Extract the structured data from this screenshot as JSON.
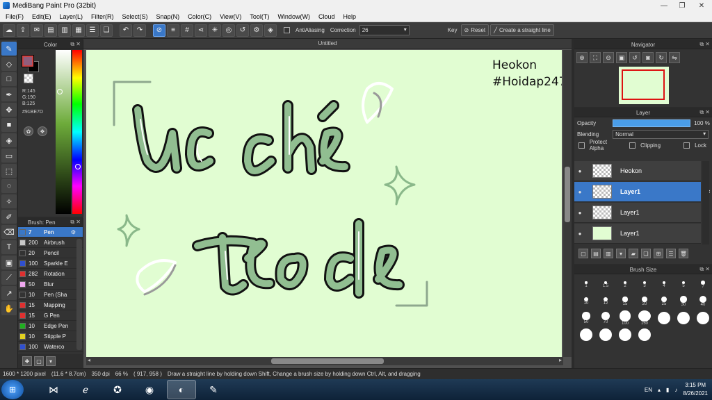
{
  "window": {
    "title": "MediBang Paint Pro (32bit)"
  },
  "menu": [
    "File(F)",
    "Edit(E)",
    "Layer(L)",
    "Filter(R)",
    "Select(S)",
    "Snap(N)",
    "Color(C)",
    "View(V)",
    "Tool(T)",
    "Window(W)",
    "Cloud",
    "Help"
  ],
  "toolbar": {
    "antialiasing_label": "AntiAliasing",
    "correction_label": "Correction",
    "correction_value": "26",
    "key_label": "Key",
    "reset_label": "Reset",
    "straight_line_label": "Create a straight line"
  },
  "color_panel": {
    "title": "Color",
    "r": "R:145",
    "g": "G:190",
    "b": "B:125",
    "hex": "#91BE7D",
    "fg_color": "#915E7D"
  },
  "brush_panel": {
    "title": "Brush: Pen",
    "brushes": [
      {
        "size": "7",
        "name": "Pen",
        "color": "#3a78c8",
        "selected": true
      },
      {
        "size": "200",
        "name": "Airbrush",
        "color": "#c8c8c8"
      },
      {
        "size": "20",
        "name": "Pencil",
        "color": "#333333"
      },
      {
        "size": "100",
        "name": "Sparkle E",
        "color": "#3050d0"
      },
      {
        "size": "282",
        "name": "Rotation",
        "color": "#e03030"
      },
      {
        "size": "50",
        "name": "Blur",
        "color": "#f0a8f0"
      },
      {
        "size": "10",
        "name": "Pen (Sha",
        "color": "#333333"
      },
      {
        "size": "15",
        "name": "Mapping",
        "color": "#e03030"
      },
      {
        "size": "15",
        "name": "G Pen",
        "color": "#e03030"
      },
      {
        "size": "10",
        "name": "Edge Pen",
        "color": "#20b020"
      },
      {
        "size": "10",
        "name": "Stipple P",
        "color": "#e0d020"
      },
      {
        "size": "100",
        "name": "Waterco",
        "color": "#3050d0"
      }
    ]
  },
  "document": {
    "tab_title": "Untitled",
    "signature_line1": "Heokon",
    "signature_line2": "#Hoidap247"
  },
  "navigator": {
    "title": "Navigator"
  },
  "layer_panel": {
    "title": "Layer",
    "opacity_label": "Opacity",
    "opacity_value": "100 %",
    "opacity_fraction": 1.0,
    "blending_label": "Blending",
    "blending_value": "Normal",
    "protect_alpha_label": "Protect Alpha",
    "clipping_label": "Clipping",
    "lock_label": "Lock",
    "layers": [
      {
        "name": "Heokon",
        "selected": false,
        "thumb": "checker"
      },
      {
        "name": "Layer1",
        "selected": true,
        "thumb": "checker"
      },
      {
        "name": "Layer1",
        "selected": false,
        "thumb": "checker"
      },
      {
        "name": "Layer1",
        "selected": false,
        "thumb": "green"
      }
    ]
  },
  "brush_size": {
    "title": "Brush Size",
    "sizes": [
      "1",
      "1.5",
      "2",
      "3",
      "4",
      "5",
      "7",
      "10",
      "12",
      "15",
      "20",
      "25",
      "30",
      "40",
      "50",
      "70",
      "100",
      "150"
    ]
  },
  "status": {
    "dimensions": "1600 * 1200 pixel",
    "physical": "(11.6 * 8.7cm)",
    "dpi": "350 dpi",
    "zoom": "66 %",
    "cursor": "( 917, 958 )",
    "hint": "Draw a straight line by holding down Shift, Change a brush size by holding down Ctrl, Alt, and dragging"
  },
  "taskbar": {
    "lang": "EN",
    "time": "3:15 PM",
    "date": "8/26/2021"
  },
  "colors": {
    "canvas_bg": "#e1fdd2",
    "lettering_green": "#91be91",
    "selection_blue": "#3a78c8"
  }
}
